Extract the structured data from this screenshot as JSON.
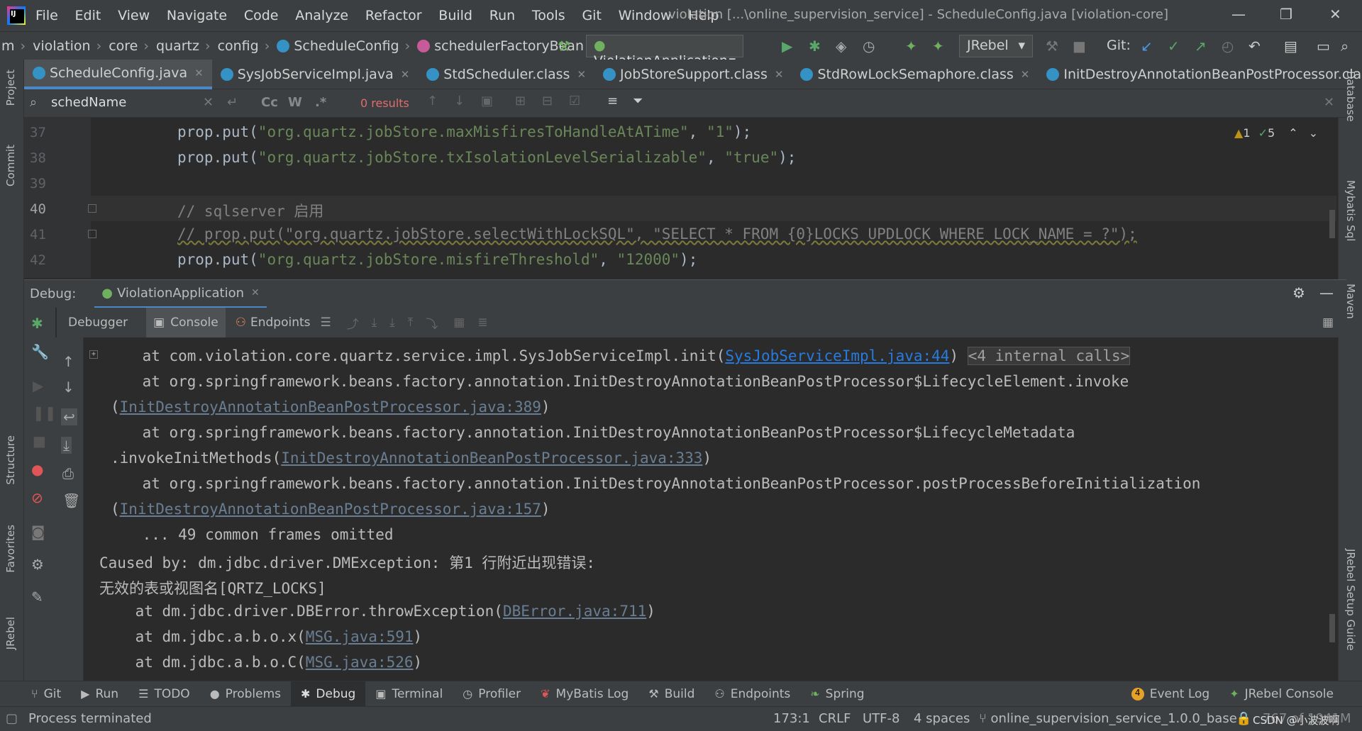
{
  "menu": [
    "File",
    "Edit",
    "View",
    "Navigate",
    "Code",
    "Analyze",
    "Refactor",
    "Build",
    "Run",
    "Tools",
    "Git",
    "Window",
    "Help"
  ],
  "window_title": "violation [...\\online_supervision_service] - ScheduleConfig.java [violation-core]",
  "breadcrumbs": {
    "b0": "m",
    "b1": "violation",
    "b2": "core",
    "b3": "quartz",
    "b4": "config",
    "b5": "ScheduleConfig",
    "b6": "schedulerFactoryBean"
  },
  "toolbar": {
    "run_config": "ViolationApplication",
    "jrebel": "JRebel",
    "git_label": "Git:"
  },
  "tabs": [
    "ScheduleConfig.java",
    "SysJobServiceImpl.java",
    "StdScheduler.class",
    "JobStoreSupport.class",
    "StdRowLockSemaphore.class",
    "InitDestroyAnnotationBeanPostProcessor.class"
  ],
  "find": {
    "query": "schedName",
    "results": "0 results",
    "cc": "Cc",
    "w": "W",
    "star": ".*"
  },
  "inspections": {
    "warnings": "1",
    "ok": "5"
  },
  "code_lines": [
    {
      "n": "37",
      "pre": "prop.put(",
      "s1": "\"org.quartz.jobStore.maxMisfiresToHandleAtATime\"",
      "mid": ", ",
      "s2": "\"1\"",
      "post": ");"
    },
    {
      "n": "38",
      "pre": "prop.put(",
      "s1": "\"org.quartz.jobStore.txIsolationLevelSerializable\"",
      "mid": ", ",
      "s2": "\"true\"",
      "post": ");"
    },
    {
      "n": "39",
      "pre": "",
      "s1": "",
      "mid": "",
      "s2": "",
      "post": ""
    },
    {
      "n": "40",
      "comment": "// sqlserver 启用"
    },
    {
      "n": "41",
      "comment": "// prop.put(\"org.quartz.jobStore.selectWithLockSQL\", \"SELECT * FROM {0}LOCKS UPDLOCK WHERE LOCK_NAME = ?\");"
    },
    {
      "n": "42",
      "pre": "prop.put(",
      "s1": "\"org.quartz.jobStore.misfireThreshold\"",
      "mid": ", ",
      "s2": "\"12000\"",
      "post": ");"
    }
  ],
  "debug": {
    "label": "Debug:",
    "session": "ViolationApplication",
    "tab_debugger": "Debugger",
    "tab_console": "Console",
    "tab_endpoints": "Endpoints"
  },
  "console": {
    "l1_pre": "    at com.violation.core.quartz.service.impl.SysJobServiceImpl.init(",
    "l1_link": "SysJobServiceImpl.java:44",
    "l1_post": ")",
    "l1_internal": "<4 internal calls>",
    "l2": "    at org.springframework.beans.factory.annotation.InitDestroyAnnotationBeanPostProcessor$LifecycleElement.invoke",
    "l3_link": "InitDestroyAnnotationBeanPostProcessor.java:389",
    "l4": "    at org.springframework.beans.factory.annotation.InitDestroyAnnotationBeanPostProcessor$LifecycleMetadata",
    "l5_pre": ".invokeInitMethods(",
    "l5_link": "InitDestroyAnnotationBeanPostProcessor.java:333",
    "l6": "    at org.springframework.beans.factory.annotation.InitDestroyAnnotationBeanPostProcessor.postProcessBeforeInitialization",
    "l7_link": "InitDestroyAnnotationBeanPostProcessor.java:157",
    "l8": "    ... 49 common frames omitted",
    "l9": "Caused by: dm.jdbc.driver.DMException: 第1 行附近出现错误:",
    "l10": "无效的表或视图名[QRTZ_LOCKS]",
    "l11_pre": "    at dm.jdbc.driver.DBError.throwException(",
    "l11_link": "DBError.java:711",
    "l12_pre": "    at dm.jdbc.a.b.o.x(",
    "l12_link": "MSG.java:591",
    "l13_pre": "    at dm.jdbc.a.b.o.C(",
    "l13_link": "MSG.java:526"
  },
  "left_tools": [
    "Project",
    "Commit",
    "Structure",
    "Favorites",
    "JRebel"
  ],
  "right_tools": [
    "Database",
    "Mybatis Sql",
    "Maven",
    "JRebel Setup Guide"
  ],
  "tool_windows": [
    "Git",
    "Run",
    "TODO",
    "Problems",
    "Debug",
    "Terminal",
    "Profiler",
    "MyBatis Log",
    "Build",
    "Endpoints",
    "Spring"
  ],
  "event_log": {
    "count": "4",
    "label": "Event Log"
  },
  "jrebel_console": "JRebel Console",
  "status": {
    "message": "Process terminated",
    "position": "173:1",
    "line_sep": "CRLF",
    "encoding": "UTF-8",
    "indent": "4 spaces",
    "branch": "online_supervision_service_1.0.0_base",
    "memory": "767 of 1941M",
    "watermark": "CSDN @小波波啊"
  }
}
